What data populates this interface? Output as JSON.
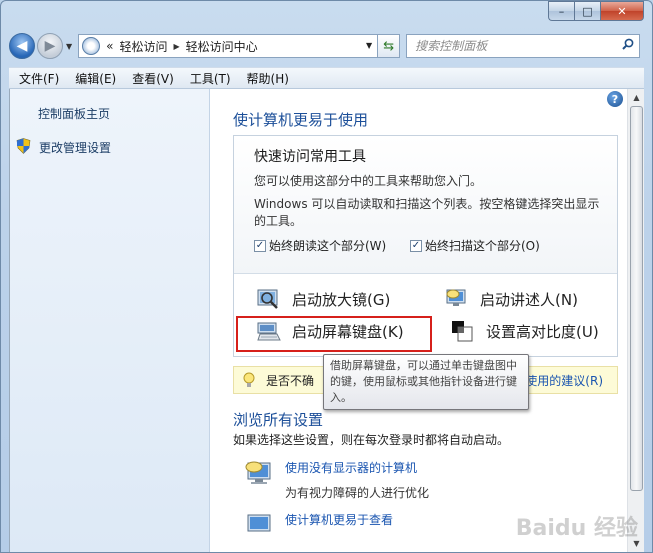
{
  "window": {
    "caption": {
      "minimize": "–",
      "maximize": "□",
      "close": "✕"
    }
  },
  "nav": {
    "breadcrumb_prefix": "«",
    "breadcrumb": [
      "轻松访问",
      "轻松访问中心"
    ],
    "search_placeholder": "搜索控制面板"
  },
  "menu": [
    "文件(F)",
    "编辑(E)",
    "查看(V)",
    "工具(T)",
    "帮助(H)"
  ],
  "sidebar": {
    "home_link": "控制面板主页",
    "admin_link": "更改管理设置"
  },
  "content": {
    "help_glyph": "?",
    "page_title": "使计算机更易于使用",
    "quick_tools": {
      "heading": "快速访问常用工具",
      "desc1": "您可以使用这部分中的工具来帮助您入门。",
      "desc2": "Windows 可以自动读取和扫描这个列表。按空格键选择突出显示的工具。",
      "checkbox_read": "始终朗读这个部分(W)",
      "checkbox_scan": "始终扫描这个部分(O)",
      "check_mark": "✓"
    },
    "tools": {
      "magnifier": "启动放大镜(G)",
      "narrator": "启动讲述人(N)",
      "keyboard": "启动屏幕键盘(K)",
      "high_contrast": "设置高对比度(U)"
    },
    "tip": {
      "text": "是否不确",
      "link_tail": "使用的建议(R)"
    },
    "tooltip": "借助屏幕键盘，可以通过单击键盘图中的键，使用鼠标或其他指针设备进行键入。",
    "browse": {
      "title": "浏览所有设置",
      "desc": "如果选择这些设置，则在每次登录时都将自动启动。",
      "item1_title": "使用没有显示器的计算机",
      "item1_sub": "为有视力障碍的人进行优化",
      "item2_title": "使计算机更易于查看"
    }
  },
  "watermark": "Baidu 经验"
}
